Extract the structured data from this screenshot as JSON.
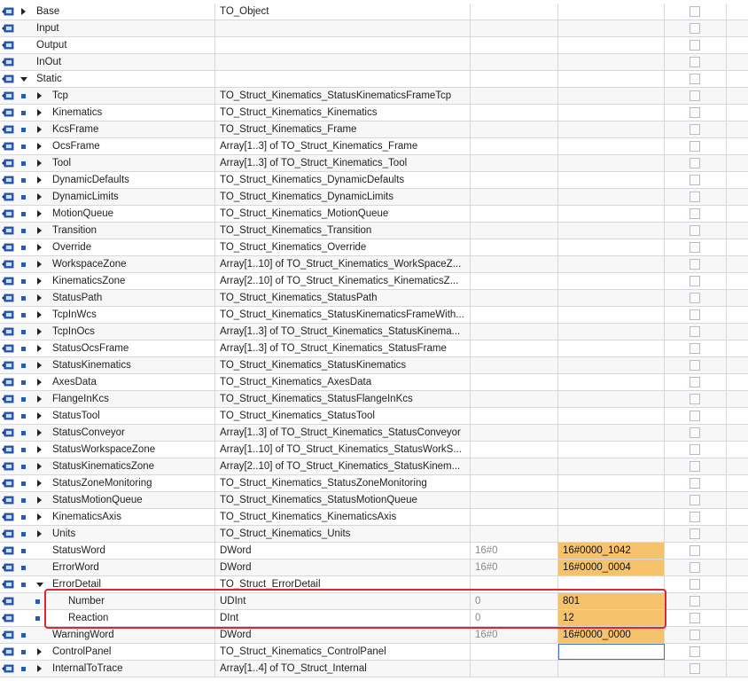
{
  "rows": [
    {
      "level": 0,
      "expander": "collapsed",
      "name": "Base",
      "type": "TO_Object",
      "start": "",
      "monitor": ""
    },
    {
      "level": 0,
      "expander": "none",
      "name": "Input",
      "type": "",
      "start": "",
      "monitor": ""
    },
    {
      "level": 0,
      "expander": "none",
      "name": "Output",
      "type": "",
      "start": "",
      "monitor": ""
    },
    {
      "level": 0,
      "expander": "none",
      "name": "InOut",
      "type": "",
      "start": "",
      "monitor": ""
    },
    {
      "level": 0,
      "expander": "expanded",
      "name": "Static",
      "type": "",
      "start": "",
      "monitor": ""
    },
    {
      "level": 1,
      "expander": "collapsed",
      "name": "Tcp",
      "type": "TO_Struct_Kinematics_StatusKinematicsFrameTcp",
      "start": "",
      "monitor": ""
    },
    {
      "level": 1,
      "expander": "collapsed",
      "name": "Kinematics",
      "type": "TO_Struct_Kinematics_Kinematics",
      "start": "",
      "monitor": ""
    },
    {
      "level": 1,
      "expander": "collapsed",
      "name": "KcsFrame",
      "type": "TO_Struct_Kinematics_Frame",
      "start": "",
      "monitor": ""
    },
    {
      "level": 1,
      "expander": "collapsed",
      "name": "OcsFrame",
      "type": "Array[1..3] of TO_Struct_Kinematics_Frame",
      "start": "",
      "monitor": ""
    },
    {
      "level": 1,
      "expander": "collapsed",
      "name": "Tool",
      "type": "Array[1..3] of TO_Struct_Kinematics_Tool",
      "start": "",
      "monitor": ""
    },
    {
      "level": 1,
      "expander": "collapsed",
      "name": "DynamicDefaults",
      "type": "TO_Struct_Kinematics_DynamicDefaults",
      "start": "",
      "monitor": ""
    },
    {
      "level": 1,
      "expander": "collapsed",
      "name": "DynamicLimits",
      "type": "TO_Struct_Kinematics_DynamicLimits",
      "start": "",
      "monitor": ""
    },
    {
      "level": 1,
      "expander": "collapsed",
      "name": "MotionQueue",
      "type": "TO_Struct_Kinematics_MotionQueue",
      "start": "",
      "monitor": ""
    },
    {
      "level": 1,
      "expander": "collapsed",
      "name": "Transition",
      "type": "TO_Struct_Kinematics_Transition",
      "start": "",
      "monitor": ""
    },
    {
      "level": 1,
      "expander": "collapsed",
      "name": "Override",
      "type": "TO_Struct_Kinematics_Override",
      "start": "",
      "monitor": ""
    },
    {
      "level": 1,
      "expander": "collapsed",
      "name": "WorkspaceZone",
      "type": "Array[1..10] of TO_Struct_Kinematics_WorkSpaceZ...",
      "start": "",
      "monitor": ""
    },
    {
      "level": 1,
      "expander": "collapsed",
      "name": "KinematicsZone",
      "type": "Array[2..10] of TO_Struct_Kinematics_KinematicsZ...",
      "start": "",
      "monitor": ""
    },
    {
      "level": 1,
      "expander": "collapsed",
      "name": "StatusPath",
      "type": "TO_Struct_Kinematics_StatusPath",
      "start": "",
      "monitor": ""
    },
    {
      "level": 1,
      "expander": "collapsed",
      "name": "TcpInWcs",
      "type": "TO_Struct_Kinematics_StatusKinematicsFrameWith...",
      "start": "",
      "monitor": ""
    },
    {
      "level": 1,
      "expander": "collapsed",
      "name": "TcpInOcs",
      "type": "Array[1..3] of TO_Struct_Kinematics_StatusKinema...",
      "start": "",
      "monitor": ""
    },
    {
      "level": 1,
      "expander": "collapsed",
      "name": "StatusOcsFrame",
      "type": "Array[1..3] of TO_Struct_Kinematics_StatusFrame",
      "start": "",
      "monitor": ""
    },
    {
      "level": 1,
      "expander": "collapsed",
      "name": "StatusKinematics",
      "type": "TO_Struct_Kinematics_StatusKinematics",
      "start": "",
      "monitor": ""
    },
    {
      "level": 1,
      "expander": "collapsed",
      "name": "AxesData",
      "type": "TO_Struct_Kinematics_AxesData",
      "start": "",
      "monitor": ""
    },
    {
      "level": 1,
      "expander": "collapsed",
      "name": "FlangeInKcs",
      "type": "TO_Struct_Kinematics_StatusFlangeInKcs",
      "start": "",
      "monitor": ""
    },
    {
      "level": 1,
      "expander": "collapsed",
      "name": "StatusTool",
      "type": "TO_Struct_Kinematics_StatusTool",
      "start": "",
      "monitor": ""
    },
    {
      "level": 1,
      "expander": "collapsed",
      "name": "StatusConveyor",
      "type": "Array[1..3] of TO_Struct_Kinematics_StatusConveyor",
      "start": "",
      "monitor": ""
    },
    {
      "level": 1,
      "expander": "collapsed",
      "name": "StatusWorkspaceZone",
      "type": "Array[1..10] of TO_Struct_Kinematics_StatusWorkS...",
      "start": "",
      "monitor": ""
    },
    {
      "level": 1,
      "expander": "collapsed",
      "name": "StatusKinematicsZone",
      "type": "Array[2..10] of TO_Struct_Kinematics_StatusKinem...",
      "start": "",
      "monitor": ""
    },
    {
      "level": 1,
      "expander": "collapsed",
      "name": "StatusZoneMonitoring",
      "type": "TO_Struct_Kinematics_StatusZoneMonitoring",
      "start": "",
      "monitor": ""
    },
    {
      "level": 1,
      "expander": "collapsed",
      "name": "StatusMotionQueue",
      "type": "TO_Struct_Kinematics_StatusMotionQueue",
      "start": "",
      "monitor": ""
    },
    {
      "level": 1,
      "expander": "collapsed",
      "name": "KinematicsAxis",
      "type": "TO_Struct_Kinematics_KinematicsAxis",
      "start": "",
      "monitor": ""
    },
    {
      "level": 1,
      "expander": "collapsed",
      "name": "Units",
      "type": "TO_Struct_Kinematics_Units",
      "start": "",
      "monitor": ""
    },
    {
      "level": 1,
      "expander": "leaf",
      "name": "StatusWord",
      "type": "DWord",
      "start": "16#0",
      "monitor": "16#0000_1042"
    },
    {
      "level": 1,
      "expander": "leaf",
      "name": "ErrorWord",
      "type": "DWord",
      "start": "16#0",
      "monitor": "16#0000_0004"
    },
    {
      "level": 1,
      "expander": "expanded",
      "name": "ErrorDetail",
      "type": "TO_Struct_ErrorDetail",
      "start": "",
      "monitor": ""
    },
    {
      "level": 2,
      "expander": "leaf",
      "name": "Number",
      "type": "UDInt",
      "start": "0",
      "monitor": "801"
    },
    {
      "level": 2,
      "expander": "leaf",
      "name": "Reaction",
      "type": "DInt",
      "start": "0",
      "monitor": "12"
    },
    {
      "level": 1,
      "expander": "leaf",
      "name": "WarningWord",
      "type": "DWord",
      "start": "16#0",
      "monitor": "16#0000_0000"
    },
    {
      "level": 1,
      "expander": "collapsed",
      "name": "ControlPanel",
      "type": "TO_Struct_Kinematics_ControlPanel",
      "start": "",
      "monitor": "",
      "focused": true
    },
    {
      "level": 1,
      "expander": "collapsed",
      "name": "InternalToTrace",
      "type": "Array[1..4] of TO_Struct_Internal",
      "start": "",
      "monitor": ""
    }
  ],
  "colors": {
    "monitor_fill": "#f6c26b",
    "highlight": "#e0262a",
    "bullet": "#2b58b8",
    "focus": "#3b6fd8"
  },
  "icons": {
    "io": "interface-tag-icon",
    "expand": "triangle-right-icon",
    "collapse": "triangle-down-icon",
    "member": "square-bullet-icon",
    "checkbox": "checkbox"
  }
}
